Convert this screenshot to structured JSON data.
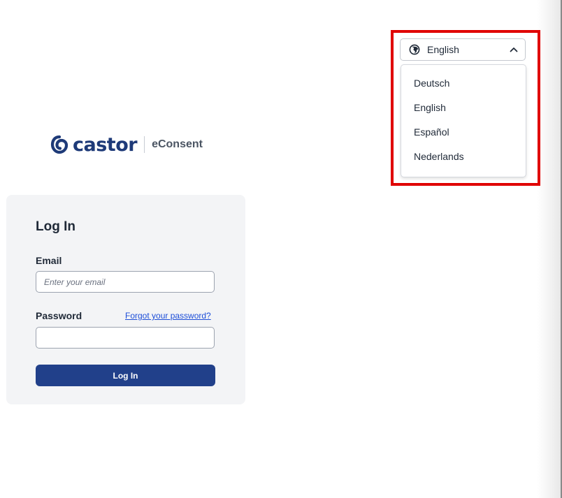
{
  "brand": {
    "name": "castor",
    "product": "eConsent",
    "color": "#1e3a78"
  },
  "login": {
    "title": "Log In",
    "email_label": "Email",
    "email_placeholder": "Enter your email",
    "email_value": "",
    "password_label": "Password",
    "password_value": "",
    "forgot_link": "Forgot your password?",
    "submit_label": "Log In",
    "button_color": "#21408a"
  },
  "language": {
    "icon": "globe-icon",
    "selected": "English",
    "expanded": true,
    "options": [
      "Deutsch",
      "English",
      "Español",
      "Nederlands"
    ],
    "highlight_color": "#e00000"
  }
}
